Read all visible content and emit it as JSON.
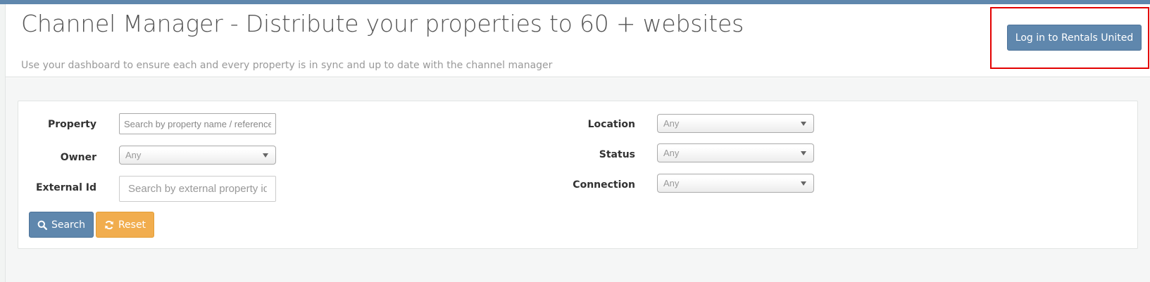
{
  "header": {
    "title": "Channel Manager - Distribute your properties to 60 + websites",
    "subtitle": "Use your dashboard to ensure each and every property is in sync and up to date with the channel manager",
    "login_label": "Log in to Rentals United"
  },
  "filters": {
    "property": {
      "label": "Property",
      "placeholder": "Search by property name / reference"
    },
    "owner": {
      "label": "Owner",
      "value": "Any"
    },
    "external_id": {
      "label": "External Id",
      "placeholder": "Search by external property id"
    },
    "location": {
      "label": "Location",
      "value": "Any"
    },
    "status": {
      "label": "Status",
      "value": "Any"
    },
    "connection": {
      "label": "Connection",
      "value": "Any"
    }
  },
  "actions": {
    "search_label": "Search",
    "reset_label": "Reset"
  },
  "icons": {
    "search": "search-icon",
    "reset": "refresh-icon"
  },
  "colors": {
    "primary": "#5f87ad",
    "warning": "#f1ad4e",
    "highlight": "#e30000"
  }
}
